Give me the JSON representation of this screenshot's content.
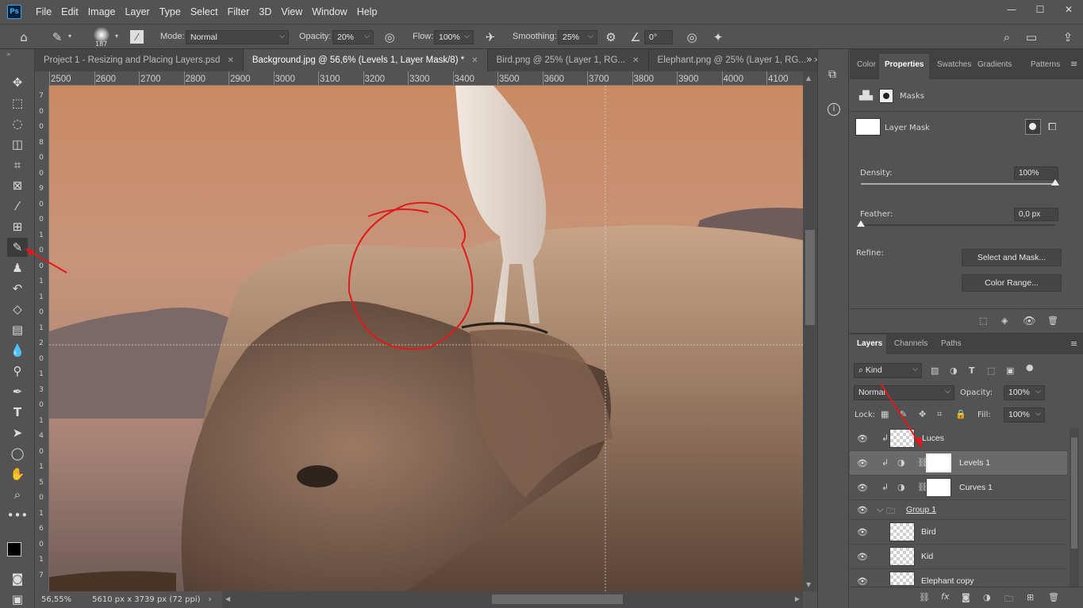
{
  "app": {
    "logo": "Ps"
  },
  "menu": [
    "File",
    "Edit",
    "Image",
    "Layer",
    "Type",
    "Select",
    "Filter",
    "3D",
    "View",
    "Window",
    "Help"
  ],
  "window_controls": {
    "minimize": "—",
    "maximize": "☐",
    "close": "✕"
  },
  "options": {
    "brush_size": "187",
    "mode_label": "Mode:",
    "mode_value": "Normal",
    "opacity_label": "Opacity:",
    "opacity_value": "20%",
    "flow_label": "Flow:",
    "flow_value": "100%",
    "smoothing_label": "Smoothing:",
    "smoothing_value": "25%",
    "angle_value": "0°"
  },
  "tabs": [
    {
      "label": "Project 1 - Resizing and Placing Layers.psd",
      "close": "✕"
    },
    {
      "label": "Background.jpg @ 56,6% (Levels 1, Layer Mask/8) *",
      "close": "✕"
    },
    {
      "label": "Bird.png @ 25% (Layer 1, RG...",
      "close": "✕"
    },
    {
      "label": "Elephant.png @ 25% (Layer 1, RG...",
      "close": "✕"
    }
  ],
  "tab_overflow": "»",
  "ruler_h": [
    "2500",
    "2600",
    "2700",
    "2800",
    "2900",
    "3000",
    "3100",
    "3200",
    "3300",
    "3400",
    "3500",
    "3600",
    "3700",
    "3800",
    "3900",
    "4000",
    "4100"
  ],
  "ruler_v": [
    "7",
    "0",
    "0",
    "8",
    "0",
    "0",
    "9",
    "0",
    "0",
    "1",
    "0",
    "0",
    "1",
    "1",
    "0",
    "1",
    "2",
    "0",
    "1",
    "3",
    "0",
    "1",
    "4",
    "0",
    "1",
    "5",
    "0",
    "1",
    "6",
    "0",
    "1",
    "7"
  ],
  "status": {
    "zoom": "56,55%",
    "doc_info": "5610 px x 3739 px (72 ppi)",
    "arrow": "›"
  },
  "properties": {
    "tabs": [
      "Color",
      "Properties",
      "Swatches",
      "Gradients",
      "Patterns"
    ],
    "section": "Masks",
    "mask_label": "Layer Mask",
    "density_label": "Density:",
    "density_value": "100%",
    "density_level": 100,
    "feather_label": "Feather:",
    "feather_value": "0,0 px",
    "feather_level": 0,
    "refine_label": "Refine:",
    "select_mask_btn": "Select and Mask...",
    "color_range_btn": "Color Range..."
  },
  "layers_panel": {
    "tabs": [
      "Layers",
      "Channels",
      "Paths"
    ],
    "filter_label": "Kind",
    "blend_mode": "Normal",
    "opacity_label": "Opacity:",
    "opacity_value": "100%",
    "lock_label": "Lock:",
    "fill_label": "Fill:",
    "fill_value": "100%",
    "layers": [
      {
        "name": "Luces"
      },
      {
        "name": "Levels 1"
      },
      {
        "name": "Curves 1"
      },
      {
        "name": "Group 1"
      },
      {
        "name": "Bird"
      },
      {
        "name": "Kid"
      },
      {
        "name": "Elephant copy"
      }
    ],
    "footer_icons": [
      "link-icon",
      "fx-icon",
      "mask-icon",
      "adjustment-icon",
      "folder-icon",
      "new-layer-icon",
      "trash-icon"
    ]
  },
  "colors": {
    "accent_red": "#e0191b",
    "panel_bg": "#535353",
    "dark_bg": "#424242"
  }
}
